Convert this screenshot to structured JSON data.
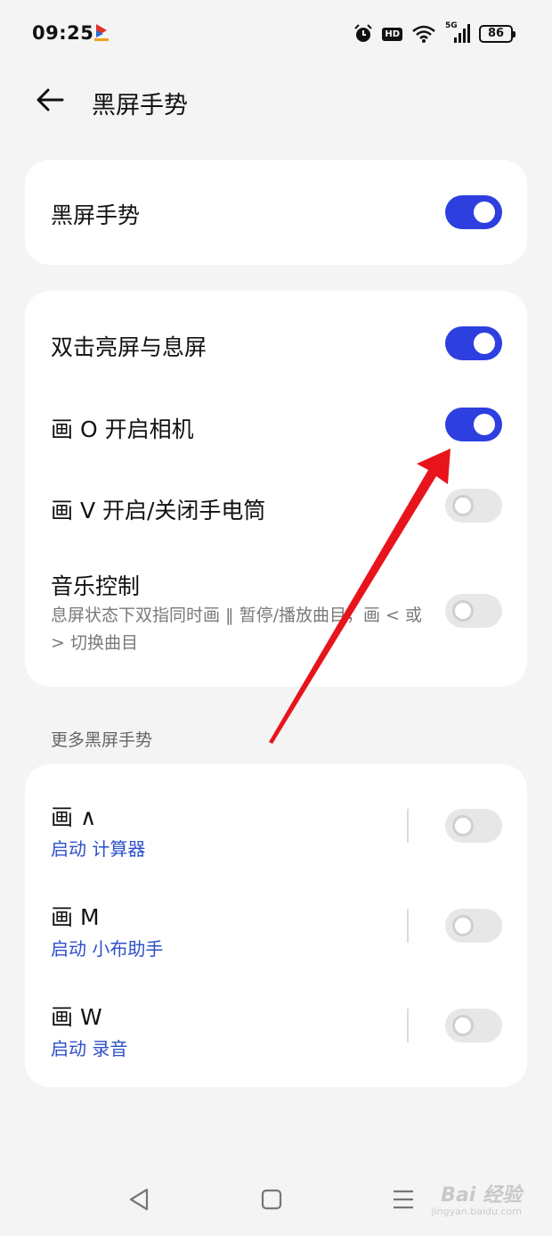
{
  "status_bar": {
    "time": "09:25",
    "hd_badge": "HD",
    "signal_label": "5G",
    "battery": "86",
    "icons": [
      "app-logo-icon",
      "alarm-icon",
      "hd-icon",
      "wifi-icon",
      "signal-icon",
      "battery-icon"
    ]
  },
  "header": {
    "back_icon": "arrow-left-icon",
    "title": "黑屏手势"
  },
  "master_card": {
    "title": "黑屏手势",
    "enabled": true
  },
  "gesture_card": {
    "items": [
      {
        "title": "双击亮屏与息屏",
        "enabled": true
      },
      {
        "title": "画 O 开启相机",
        "enabled": true
      },
      {
        "title": "画 V 开启/关闭手电筒",
        "enabled": false
      },
      {
        "title": "音乐控制",
        "description": "息屏状态下双指同时画 ‖ 暂停/播放曲目，画 < 或 > 切换曲目",
        "enabled": false
      }
    ]
  },
  "more_section": {
    "label": "更多黑屏手势",
    "items": [
      {
        "title": "画 ∧",
        "subtitle": "启动 计算器",
        "enabled": false
      },
      {
        "title": "画 M",
        "subtitle": "启动 小布助手",
        "enabled": false
      },
      {
        "title": "画 W",
        "subtitle": "启动 录音",
        "enabled": false
      }
    ]
  },
  "nav_bar": {
    "icons": [
      "back-triangle-icon",
      "home-square-icon",
      "recents-menu-icon"
    ]
  },
  "watermark": {
    "text": "Bai 经验",
    "url": "jingyan.baidu.com"
  },
  "colors": {
    "accent": "#2e3fe0",
    "link": "#2e4fc9",
    "background": "#f4f4f4",
    "card": "#ffffff",
    "annotation_arrow": "#e8141b"
  }
}
